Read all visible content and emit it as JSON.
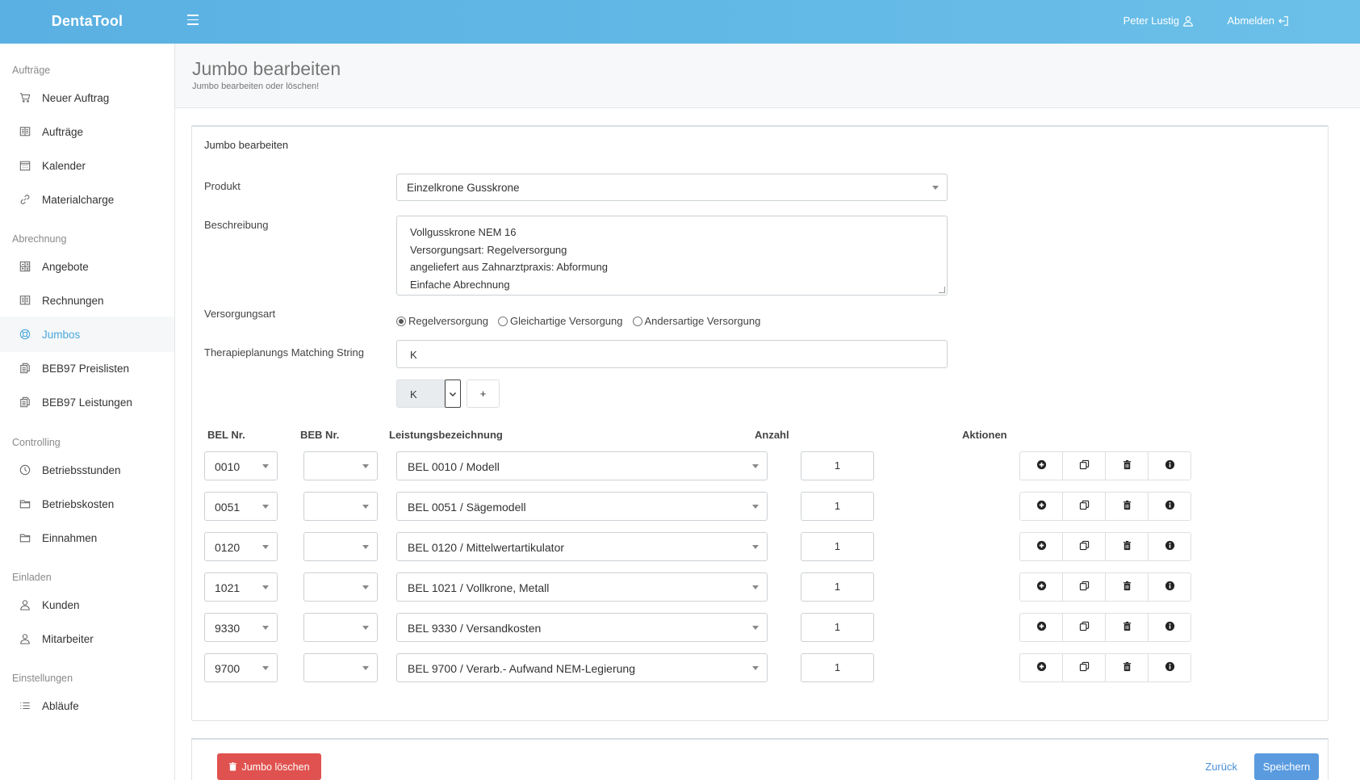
{
  "app": {
    "brand": "DentaTool"
  },
  "topbar": {
    "user": "Peter Lustig",
    "logout": "Abmelden"
  },
  "sidebar": {
    "sections": [
      {
        "title": "Aufträge",
        "items": [
          {
            "label": "Neuer Auftrag",
            "icon": "cart-icon"
          },
          {
            "label": "Aufträge",
            "icon": "book-icon"
          },
          {
            "label": "Kalender",
            "icon": "calendar-icon"
          },
          {
            "label": "Materialcharge",
            "icon": "link-icon"
          }
        ]
      },
      {
        "title": "Abrechnung",
        "items": [
          {
            "label": "Angebote",
            "icon": "calculator-icon"
          },
          {
            "label": "Rechnungen",
            "icon": "book-icon"
          },
          {
            "label": "Jumbos",
            "icon": "lifebuoy-icon",
            "active": true
          },
          {
            "label": "BEB97 Preislisten",
            "icon": "copy-icon"
          },
          {
            "label": "BEB97 Leistungen",
            "icon": "copy-icon"
          }
        ]
      },
      {
        "title": "Controlling",
        "items": [
          {
            "label": "Betriebsstunden",
            "icon": "clock-icon"
          },
          {
            "label": "Betriebskosten",
            "icon": "folder-icon"
          },
          {
            "label": "Einnahmen",
            "icon": "folder-icon"
          }
        ]
      },
      {
        "title": "Einladen",
        "items": [
          {
            "label": "Kunden",
            "icon": "user-icon"
          },
          {
            "label": "Mitarbeiter",
            "icon": "user-icon"
          }
        ]
      },
      {
        "title": "Einstellungen",
        "items": [
          {
            "label": "Abläufe",
            "icon": "list-icon"
          }
        ]
      }
    ]
  },
  "page": {
    "title": "Jumbo bearbeiten",
    "subtitle": "Jumbo bearbeiten oder löschen!"
  },
  "form": {
    "card_title": "Jumbo bearbeiten",
    "produkt_label": "Produkt",
    "produkt_value": "Einzelkrone Gusskrone",
    "beschreibung_label": "Beschreibung",
    "beschreibung_lines": [
      "Vollgusskrone NEM 16",
      "Versorgungsart: Regelversorgung",
      "angeliefert aus Zahnarztpraxis: Abformung",
      "Einfache Abrechnung"
    ],
    "versorgungsart_label": "Versorgungsart",
    "versorgungsart_options": [
      "Regelversorgung",
      "Gleichartige Versorgung",
      "Andersartige Versorgung"
    ],
    "versorgungsart_selected": "Regelversorgung",
    "matching_label": "Therapieplanungs Matching String",
    "matching_value": "K",
    "k_select_value": "K",
    "add_label": "+"
  },
  "table": {
    "headers": {
      "bel": "BEL Nr.",
      "beb": "BEB Nr.",
      "leistung": "Leistungsbezeichnung",
      "anzahl": "Anzahl",
      "aktionen": "Aktionen"
    },
    "rows": [
      {
        "bel": "0010",
        "beb": "",
        "leistung": "BEL 0010 / Modell",
        "anzahl": "1"
      },
      {
        "bel": "0051",
        "beb": "",
        "leistung": "BEL 0051 / Sägemodell",
        "anzahl": "1"
      },
      {
        "bel": "0120",
        "beb": "",
        "leistung": "BEL 0120 / Mittelwertartikulator",
        "anzahl": "1"
      },
      {
        "bel": "1021",
        "beb": "",
        "leistung": "BEL 1021 / Vollkrone, Metall",
        "anzahl": "1"
      },
      {
        "bel": "9330",
        "beb": "",
        "leistung": "BEL 9330 / Versandkosten",
        "anzahl": "1"
      },
      {
        "bel": "9700",
        "beb": "",
        "leistung": "BEL 9700 / Verarb.- Aufwand NEM-Legierung",
        "anzahl": "1"
      }
    ],
    "action_icons": [
      "plus-circle-icon",
      "copy-icon",
      "trash-icon",
      "info-icon"
    ]
  },
  "footer": {
    "delete_label": "Jumbo löschen",
    "back_label": "Zurück",
    "save_label": "Speichern"
  },
  "colors": {
    "topbar": "#5ab0e2",
    "accent": "#4aa8dd",
    "danger": "#e0524f",
    "primary": "#5a9be0"
  }
}
